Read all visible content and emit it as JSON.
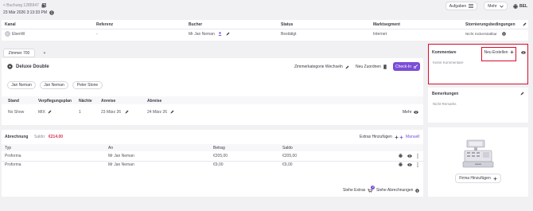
{
  "header": {
    "back_label": "< Buchung 1285947",
    "datetime": "23 Mär 2026 3:13:33 PM",
    "tasks_label": "Aufgaben",
    "more_label": "Mehr",
    "lang_label": "BEL"
  },
  "channel_table": {
    "headers": [
      "Kanal",
      "Referenz",
      "Bucher",
      "Status",
      "Marktsegment",
      "Stornierungsbedingungen"
    ],
    "channel": "EbenW",
    "channel_avatar": "E",
    "reference": "-",
    "booker": "Mr Jan Neman",
    "status": "Bestätigt",
    "segment": "Internet",
    "cancellation": "Nicht rückerstattbar"
  },
  "room_tabs": {
    "active": "Zimmer 700",
    "add": "+"
  },
  "room": {
    "name": "Deluxe Double",
    "change_category": "Zimmerkategorie Wechseln",
    "reassign": "Neu Zuordnen",
    "checkin": "Check-In",
    "guests": [
      "Jan Neman",
      "Jan Neman",
      "Peter Stone"
    ]
  },
  "stay_table": {
    "headers": [
      "Stand",
      "Verpflegungsplan",
      "Nächte",
      "Anreise",
      "Abreise"
    ],
    "status": "No Show",
    "plan": "MIX",
    "nights": "1",
    "arrival": "23 März 26",
    "departure": "24 März 26",
    "more": "Mehr"
  },
  "billing": {
    "title": "Abrechnung",
    "balance_label": "Saldo:",
    "balance_value": "€214.00",
    "extras_add": "Extras Hinzufügen",
    "manual": "Manuell",
    "headers": [
      "Typ",
      "An",
      "Betrag",
      "Saldo"
    ],
    "rows": [
      {
        "type": "Proforma",
        "to": "Mr Jan Neman",
        "amount": "€205,00",
        "balance": "€205,00"
      },
      {
        "type": "Proforma",
        "to": "Mr Jan Neman",
        "amount": "€9,00",
        "balance": "€9,00"
      }
    ],
    "see_extras": "Siehe Extras",
    "extras_count": "2",
    "see_billings": "Siehe Abrechnungen"
  },
  "comments": {
    "title": "Kommentare",
    "new_label": "Neu Erstellen",
    "empty": "Keine Kommentare"
  },
  "remarks": {
    "title": "Bemerkungen",
    "empty": "Nicht Remarks"
  },
  "company": {
    "add_label": "Firma Hinzufügen"
  },
  "colors": {
    "accent": "#7c4dd6",
    "highlight": "#d60f2a",
    "balance": "#d6334b"
  }
}
